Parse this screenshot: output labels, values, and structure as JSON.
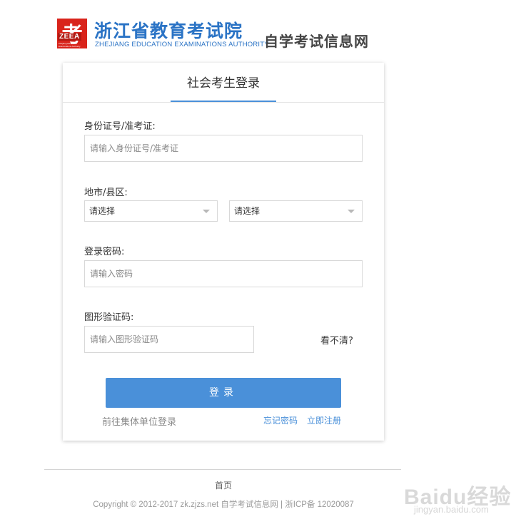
{
  "header": {
    "logo_char": "考",
    "logo_abbr": "ZEEA",
    "logo_sub": "Zhejiang Education Examinations Authority",
    "title": "浙江省教育考试院",
    "subtitle": "ZHEJIANG EDUCATION EXAMINATIONS AUTHORITY",
    "site_name": "自学考试信息网"
  },
  "login": {
    "tab_title": "社会考生登录",
    "id_label": "身份证号/准考证:",
    "id_placeholder": "请输入身份证号/准考证",
    "region_label": "地市/县区:",
    "city_select": "请选择",
    "district_select": "请选择",
    "password_label": "登录密码:",
    "password_placeholder": "请输入密码",
    "captcha_label": "图形验证码:",
    "captcha_placeholder": "请输入图形验证码",
    "captcha_refresh": "看不清?",
    "login_button": "登录",
    "group_login_link": "前往集体单位登录",
    "forgot_link": "忘记密码",
    "register_link": "立即注册"
  },
  "footer": {
    "home_link": "首页",
    "copyright": "Copyright © 2012-2017 zk.zjzs.net 自学考试信息网  |  浙ICP备 12020087"
  },
  "watermark": {
    "brand": "Baidu经验",
    "url": "jingyan.baidu.com"
  },
  "colors": {
    "accent": "#4a90d9",
    "brand_red": "#d9241b",
    "title_blue": "#2a73c5"
  }
}
